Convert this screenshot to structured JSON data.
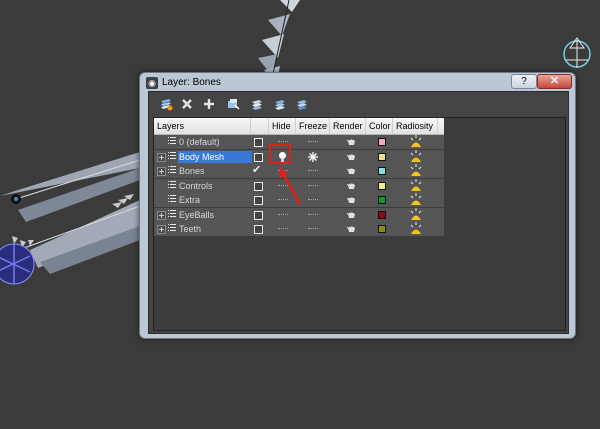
{
  "window": {
    "title": "Layer: Bones",
    "help_label": "?",
    "close_label": "✕"
  },
  "toolbar": {
    "icons": [
      "create-layer-icon",
      "delete-layer-icon",
      "add-to-layer-icon",
      "select-objects-icon",
      "highlight-layer-icon",
      "hide-all-icon",
      "freeze-all-icon"
    ]
  },
  "columns": {
    "layers": "Layers",
    "hide": "Hide",
    "freeze": "Freeze",
    "render": "Render",
    "color": "Color",
    "radiosity": "Radiosity"
  },
  "rows": [
    {
      "name": "0 (default)",
      "expander": false,
      "current": false,
      "selected": false,
      "hide": "dash",
      "freeze": "dash",
      "color": "#f3a6c2"
    },
    {
      "name": "Body Mesh",
      "expander": true,
      "current": false,
      "selected": true,
      "hide": "bulb",
      "freeze": "snowflake",
      "color": "#efdf8c"
    },
    {
      "name": "Bones",
      "expander": true,
      "current": true,
      "selected": false,
      "hide": "dash",
      "freeze": "dash",
      "color": "#7fe3e3"
    },
    {
      "name": "Controls",
      "expander": false,
      "current": false,
      "selected": false,
      "hide": "dash",
      "freeze": "dash",
      "color": "#f0ec8a"
    },
    {
      "name": "Extra",
      "expander": false,
      "current": false,
      "selected": false,
      "hide": "dash",
      "freeze": "dash",
      "color": "#0f9a2e"
    },
    {
      "name": "EyeBalls",
      "expander": true,
      "current": false,
      "selected": false,
      "hide": "dash",
      "freeze": "dash",
      "color": "#8b0d12"
    },
    {
      "name": "Teeth",
      "expander": true,
      "current": false,
      "selected": false,
      "hide": "dash",
      "freeze": "dash",
      "color": "#8d8f15"
    }
  ],
  "colors": {
    "selection": "#3a78d8",
    "annotation": "#e0201a"
  }
}
